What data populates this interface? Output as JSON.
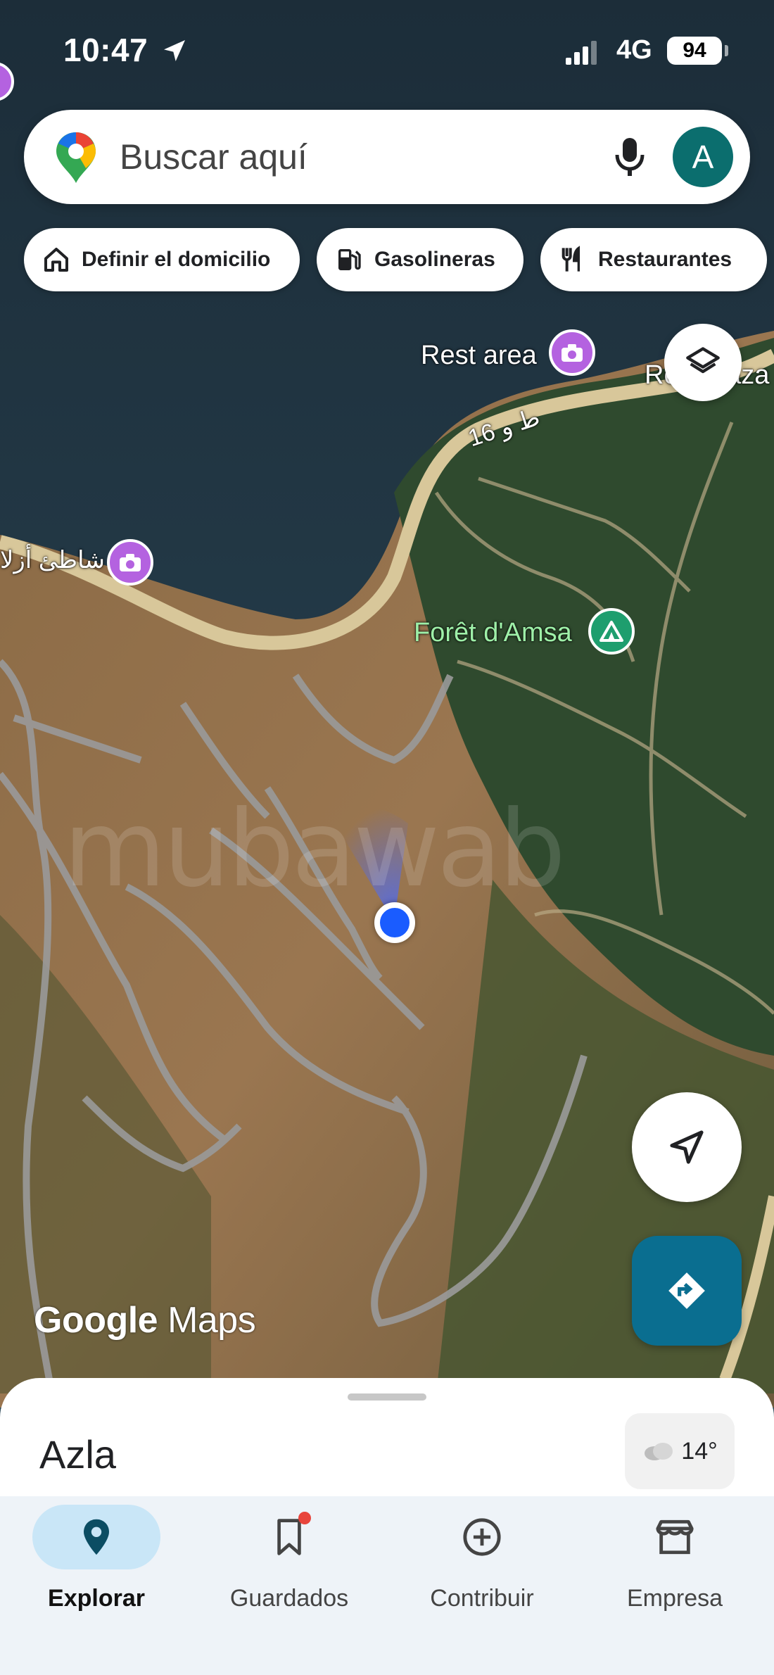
{
  "status_bar": {
    "time": "10:47",
    "network": "4G",
    "battery": "94"
  },
  "search": {
    "placeholder": "Buscar aquí",
    "avatar_letter": "A"
  },
  "chips": [
    {
      "label": "Definir el domicilio",
      "icon": "home-icon"
    },
    {
      "label": "Gasolineras",
      "icon": "gas-station-icon"
    },
    {
      "label": "Restaurantes",
      "icon": "restaurant-icon"
    }
  ],
  "map": {
    "labels": {
      "rest_area": "Rest area",
      "rest_area2": "Rest Raza",
      "road": "ط و 16",
      "beach": "شاطئ أزلا",
      "forest": "Forêt d'Amsa",
      "watermark": "mubawab"
    },
    "logo": {
      "google": "Google",
      "maps": "Maps"
    }
  },
  "sheet": {
    "place": "Azla",
    "temperature": "14°"
  },
  "nav": [
    {
      "label": "Explorar",
      "icon": "explore-pin-icon",
      "active": true
    },
    {
      "label": "Guardados",
      "icon": "bookmark-icon",
      "active": false
    },
    {
      "label": "Contribuir",
      "icon": "plus-circle-icon",
      "active": false
    },
    {
      "label": "Empresa",
      "icon": "storefront-icon",
      "active": false
    }
  ],
  "colors": {
    "accent": "#0a6e90",
    "avatar": "#0b6e6e",
    "nav_active": "#c9e6f7",
    "badge": "#e8453c",
    "location_dot": "#1a5cff"
  }
}
